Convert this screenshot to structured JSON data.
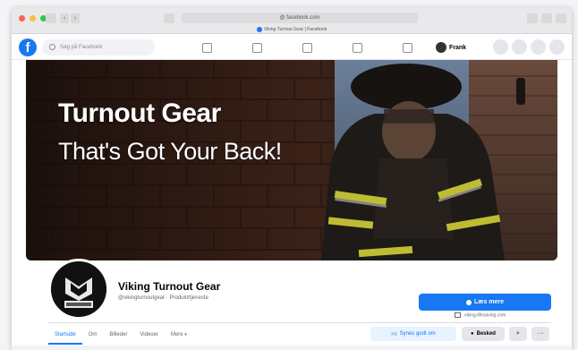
{
  "browser": {
    "url": "@ facebook.com",
    "tab_title": "Viking Turnout Gear | Facebook"
  },
  "fb_nav": {
    "logo": "f",
    "search_placeholder": "Søg på Facebook",
    "profile_name": "Frank"
  },
  "cover": {
    "headline_1": "Turnout Gear",
    "headline_2": "That's Got Your Back!"
  },
  "page": {
    "name": "Viking Turnout Gear",
    "handle": "@vikingturnoutgear · Produkt/tjeneste",
    "cta_label": "Læs mere",
    "cta_link": "viking-lifesaving.com"
  },
  "tabs": [
    {
      "label": "Startside"
    },
    {
      "label": "Om"
    },
    {
      "label": "Billeder"
    },
    {
      "label": "Videoer"
    },
    {
      "label": "Mere"
    }
  ],
  "actions": {
    "like_label": "Synes godt om",
    "message_label": "Besked",
    "search_glyph": "⌕",
    "more_glyph": "···"
  },
  "colors": {
    "fb_blue": "#1877f2",
    "light_blue_bg": "#e7f3ff",
    "gray_button": "#e4e6eb"
  },
  "icons": [
    "facebook-logo-icon",
    "search-icon",
    "home-icon",
    "watch-icon",
    "marketplace-icon",
    "groups-icon",
    "gaming-icon",
    "menu-icon",
    "messenger-icon",
    "bell-icon",
    "chevron-down-icon",
    "thumbs-up-icon",
    "message-icon",
    "link-icon"
  ]
}
